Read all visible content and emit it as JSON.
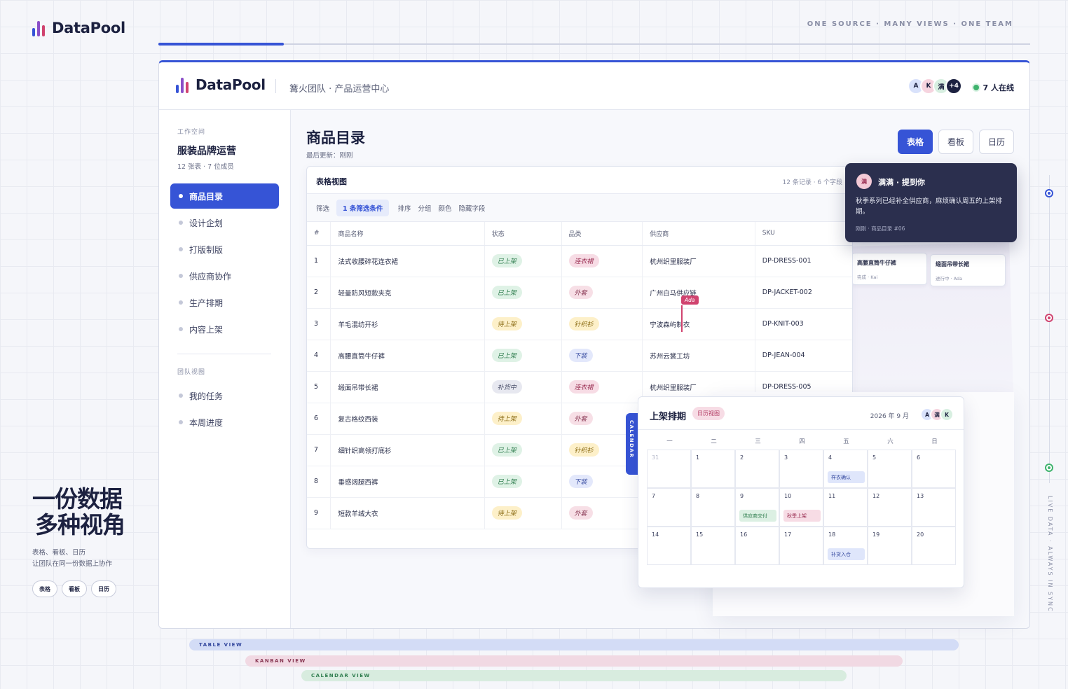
{
  "brand": {
    "name": "DataPool",
    "bar_colors": [
      "#3654d6",
      "#8a4fc8",
      "#d0436f"
    ]
  },
  "tagline": "ONE SOURCE · MANY VIEWS · ONE TEAM",
  "progress": {
    "fraction": 0.144
  },
  "window": {
    "brand": "DataPool",
    "subtitle": "篝火团队 · 产品运营中心",
    "avatars": [
      {
        "label": "A",
        "bg": "#d9e2fb"
      },
      {
        "label": "K",
        "bg": "#f6d4df"
      },
      {
        "label": "满",
        "bg": "#d8efe1"
      },
      {
        "label": "+4",
        "bg": "#1c2140"
      }
    ],
    "online": "7 人在线"
  },
  "sidebar": {
    "workspace_label": "工作空间",
    "workspace_name": "服装品牌运营",
    "workspace_meta": "12 张表 · 7 位成员",
    "items": [
      "商品目录",
      "设计企划",
      "打版制版",
      "供应商协作",
      "生产排期",
      "内容上架"
    ],
    "team_label": "团队视图",
    "team_items": [
      "我的任务",
      "本周进度"
    ]
  },
  "content": {
    "title": "商品目录",
    "updated": "最后更新：刚刚",
    "views": [
      "表格",
      "看板",
      "日历"
    ]
  },
  "table": {
    "title": "表格视图",
    "meta": "12 条记录 · 6 个字段",
    "toolbar": [
      "筛选",
      "1 条筛选条件",
      "排序",
      "分组",
      "颜色",
      "隐藏字段"
    ],
    "columns": [
      "#",
      "商品名称",
      "状态",
      "品类",
      "供应商",
      "SKU"
    ],
    "rows": [
      [
        "1",
        "法式收腰碎花连衣裙",
        "已上架",
        "连衣裙",
        "杭州织里服装厂",
        "DP-DRESS-001"
      ],
      [
        "2",
        "轻量防风短款夹克",
        "已上架",
        "外套",
        "广州白马供应链",
        "DP-JACKET-002"
      ],
      [
        "3",
        "羊毛混纺开衫",
        "待上架",
        "针织衫",
        "宁波森屿制衣",
        "DP-KNIT-003"
      ],
      [
        "4",
        "高腰直筒牛仔裤",
        "已上架",
        "下装",
        "苏州云裳工坊",
        "DP-JEAN-004"
      ],
      [
        "5",
        "缎面吊带长裙",
        "补货中",
        "连衣裙",
        "杭州织里服装厂",
        "DP-DRESS-005"
      ],
      [
        "6",
        "复古格纹西装",
        "待上架",
        "外套",
        "",
        ""
      ],
      [
        "7",
        "细针织高领打底衫",
        "已上架",
        "针织衫",
        "",
        ""
      ],
      [
        "8",
        "垂感阔腿西裤",
        "已上架",
        "下装",
        "",
        ""
      ],
      [
        "9",
        "短款羊绒大衣",
        "待上架",
        "外套",
        "",
        ""
      ]
    ],
    "status_colors": {
      "已上架": {
        "bg": "#dff2e6",
        "fg": "#2f7d4e"
      },
      "待上架": {
        "bg": "#fdf0c9",
        "fg": "#8a6a12"
      },
      "补货中": {
        "bg": "#e7e8f0",
        "fg": "#4a4f6a"
      }
    },
    "category_colors": {
      "连衣裙": {
        "bg": "#f7dce5",
        "fg": "#9a2e52"
      },
      "外套": {
        "bg": "#f7dfe6",
        "fg": "#8a3a55"
      },
      "针织衫": {
        "bg": "#fdf0c9",
        "fg": "#8a6a12"
      },
      "下装": {
        "bg": "#e3e8fb",
        "fg": "#34489e"
      }
    }
  },
  "cursor": {
    "name": "Ada"
  },
  "kanban": {
    "cards": [
      {
        "title": "高腰直筒牛仔裤",
        "meta": "完成 · Kai"
      },
      {
        "title": "缎面吊带长裙",
        "meta": "进行中 · Ada"
      }
    ]
  },
  "notification": {
    "avatar": "满",
    "title": "满满 · 提到你",
    "body": "秋季系列已经补全供应商，麻烦确认周五的上架排期。",
    "footer": "刚刚 · 商品目录 #06"
  },
  "calendar": {
    "tab": "CALENDAR",
    "title": "上架排期",
    "badge": "日历视图",
    "month": "2026 年 9 月",
    "avatars": [
      {
        "label": "A",
        "bg": "#d9e2fb"
      },
      {
        "label": "满",
        "bg": "#f6d4df"
      },
      {
        "label": "K",
        "bg": "#d8efe1"
      }
    ],
    "weekdays": [
      "一",
      "二",
      "三",
      "四",
      "五",
      "六",
      "日"
    ],
    "weeks": [
      [
        "31",
        "1",
        "2",
        "3",
        "4",
        "5",
        "6"
      ],
      [
        "7",
        "8",
        "9",
        "10",
        "11",
        "12",
        "13"
      ],
      [
        "14",
        "15",
        "16",
        "17",
        "18",
        "19",
        "20"
      ]
    ],
    "events": [
      {
        "week": 0,
        "day": 4,
        "label": "样衣确认",
        "bg": "#dfe6fb",
        "fg": "#34489e"
      },
      {
        "week": 1,
        "day": 2,
        "label": "供应商交付",
        "bg": "#dcf0e3",
        "fg": "#2f7d4e"
      },
      {
        "week": 1,
        "day": 3,
        "label": "秋季上架",
        "bg": "#f7dce5",
        "fg": "#9a2e52"
      },
      {
        "week": 2,
        "day": 4,
        "label": "补货入仓",
        "bg": "#dfe6fb",
        "fg": "#34489e"
      }
    ]
  },
  "bottom_buttons": [
    {
      "label": "表格",
      "color": "#3654d6"
    },
    {
      "label": "看板",
      "color": "#6a4fb0"
    },
    {
      "label": "日历",
      "color": "#d0436f"
    }
  ],
  "hero": {
    "line1": "一份数据",
    "line2": "多种视角",
    "sub1": "表格、看板、日历",
    "sub2": "让团队在同一份数据上协作",
    "chips": [
      "表格",
      "看板",
      "日历"
    ]
  },
  "right_rail": {
    "text": "LIVE DATA · ALWAYS IN SYNC",
    "dot_colors": [
      "#3654d6",
      "#d0436f",
      "#3fb36d"
    ]
  },
  "bars": [
    {
      "label": "TABLE VIEW",
      "bg": "#d3dcf6",
      "fg": "#34489e"
    },
    {
      "label": "KANBAN VIEW",
      "bg": "#f1d9e3",
      "fg": "#8a3a55"
    },
    {
      "label": "CALENDAR VIEW",
      "bg": "#d8ecdf",
      "fg": "#2f7d4e"
    }
  ]
}
